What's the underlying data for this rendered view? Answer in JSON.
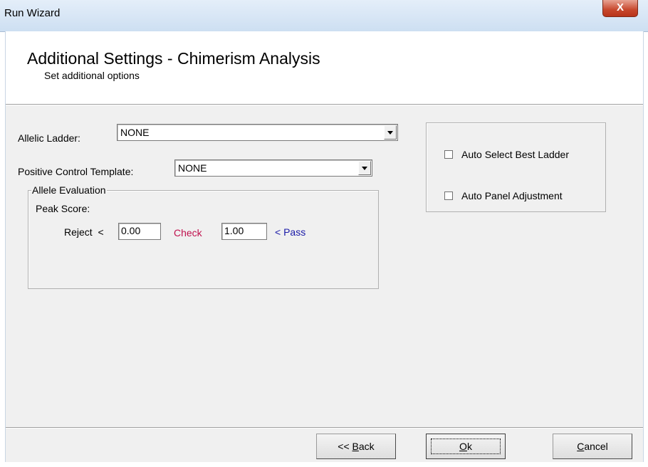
{
  "window": {
    "title": "Run Wizard",
    "close_glyph": "X"
  },
  "header": {
    "title": "Additional Settings - Chimerism Analysis",
    "subtitle": "Set additional options"
  },
  "allelic_ladder": {
    "label": "Allelic Ladder:",
    "value": "NONE"
  },
  "positive_control": {
    "label": "Positive Control Template:",
    "value": "NONE"
  },
  "allele_evaluation": {
    "legend": "Allele Evaluation",
    "peak_score_label": "Peak Score:",
    "reject_label": "Reject  <",
    "reject_value": "0.00",
    "check_label": "Check",
    "check_value": "1.00",
    "pass_label": "< Pass",
    "check_color": "#c0124e",
    "pass_color": "#1a1aa8"
  },
  "options": {
    "auto_select_best_ladder": {
      "label": "Auto Select Best Ladder",
      "checked": false
    },
    "auto_panel_adjustment": {
      "label": "Auto Panel Adjustment",
      "checked": false
    }
  },
  "buttons": {
    "back_prefix": "<< ",
    "back_key": "B",
    "back_rest": "ack",
    "ok_key": "O",
    "ok_rest": "k",
    "cancel_key": "C",
    "cancel_rest": "ancel"
  }
}
